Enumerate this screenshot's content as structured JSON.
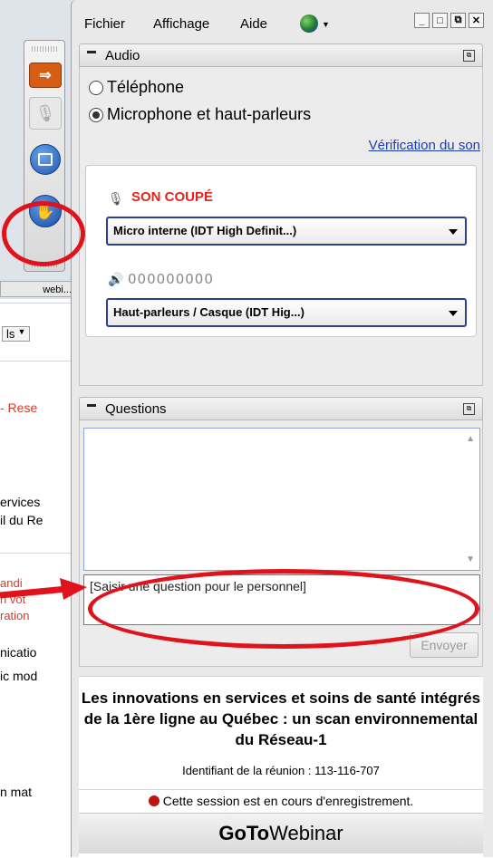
{
  "background_page": {
    "tab_label": "webi...",
    "dropdown_label": "ls",
    "lines": [
      "- Rese",
      "ervices",
      "il du Re",
      "andi",
      "n vot",
      "ration",
      "nicatio",
      "ic mod",
      "n mat"
    ]
  },
  "menu": {
    "items": [
      "Fichier",
      "Affichage",
      "Aide"
    ]
  },
  "audio": {
    "title": "Audio",
    "options": [
      "Téléphone",
      "Microphone et haut-parleurs"
    ],
    "selected_option": 1,
    "sound_check_link": "Vérification du son",
    "mute_status": "SON COUPÉ",
    "mic_device": "Micro interne (IDT High Definit...)",
    "speaker_level": "000000000",
    "speaker_device": "Haut-parleurs / Casque (IDT Hig...)"
  },
  "questions": {
    "title": "Questions",
    "input_value": "[Saisir une question pour le personnel]",
    "send_label": "Envoyer"
  },
  "session": {
    "title": "Les innovations en services et soins de santé intégrés de la 1ère ligne au Québec : un scan environnemental du Réseau-1",
    "meeting_id": "Identifiant de la réunion : 113-116-707",
    "recording_notice": "Cette session est en cours d'enregistrement."
  },
  "brand": {
    "goto": "GoTo",
    "webinar": "Webinar"
  },
  "colors": {
    "accent_red": "#e0121c",
    "link_blue": "#1a3bb8",
    "mute_red": "#e5231b"
  }
}
